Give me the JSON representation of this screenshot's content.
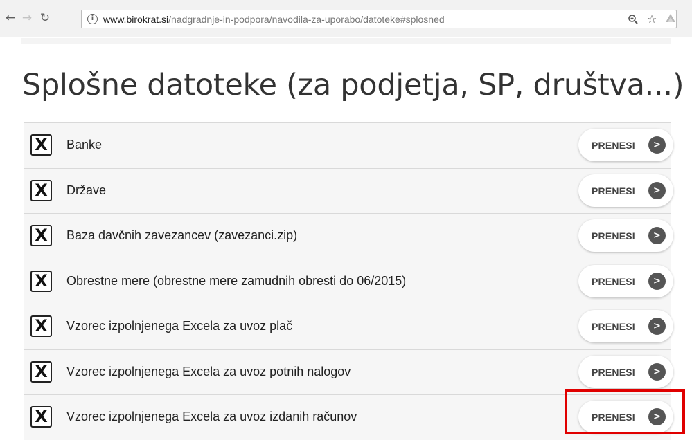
{
  "browser": {
    "url_host": "www.birokrat.si",
    "url_path": "/nadgradnje-in-podpora/navodila-za-uporabo/datoteke#splosned",
    "icons": {
      "back": "arrow-left-icon",
      "forward": "arrow-right-icon",
      "reload": "reload-icon",
      "info": "info-icon",
      "zoom": "zoom-icon",
      "bookmark": "star-icon",
      "extension": "extension-icon"
    }
  },
  "page": {
    "title": "Splošne datoteke (za podjetja, SP, društva...)",
    "download_label": "PRENESI",
    "file_icon": "excel-x-icon",
    "files": [
      {
        "name": "Banke"
      },
      {
        "name": "Države"
      },
      {
        "name": "Baza davčnih zavezancev (zavezanci.zip)"
      },
      {
        "name": "Obrestne mere (obrestne mere zamudnih obresti do 06/2015)"
      },
      {
        "name": "Vzorec izpolnjenega Excela za uvoz plač"
      },
      {
        "name": "Vzorec izpolnjenega Excela za uvoz potnih nalogov"
      },
      {
        "name": "Vzorec izpolnjenega Excela za uvoz izdanih računov"
      }
    ],
    "highlight_color": "#e00000"
  }
}
